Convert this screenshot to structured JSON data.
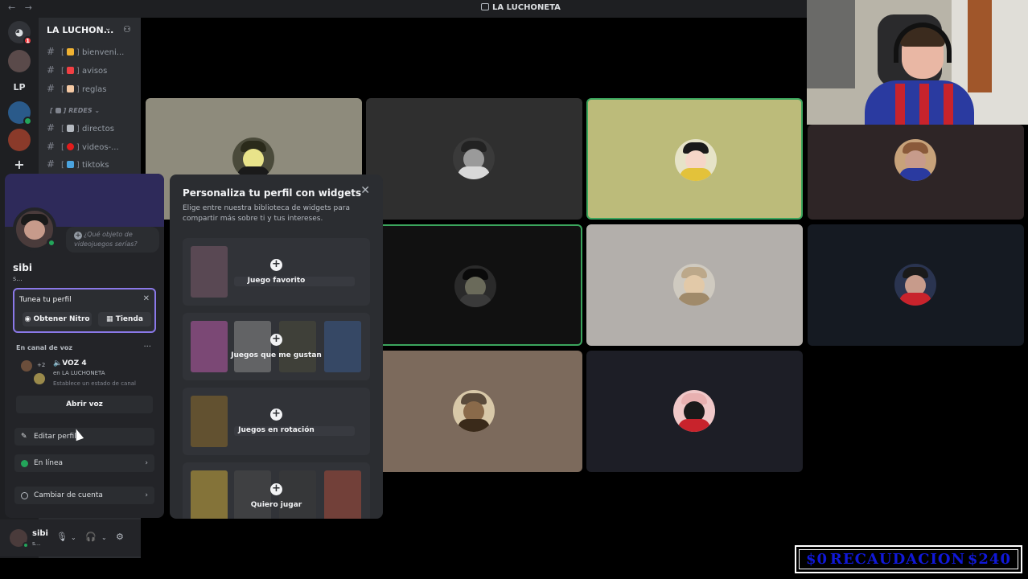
{
  "window": {
    "nav": "← →",
    "title": "LA LUCHONETA"
  },
  "rail": {
    "servers": [
      {
        "icon": "discord-icon",
        "badge": "1"
      },
      {
        "icon": "server-avatar"
      },
      {
        "label": "LP"
      },
      {
        "icon": "server-avatar"
      },
      {
        "icon": "server-avatar"
      },
      {
        "icon": "add-server-icon",
        "label": "+"
      }
    ]
  },
  "sidebar": {
    "server_name": "LA LUCHON...",
    "channels": [
      {
        "label": "bienveni...",
        "emoji_color": "#f0b232"
      },
      {
        "label": "avisos",
        "emoji_color": "#f23f43"
      },
      {
        "label": "reglas",
        "emoji_color": "#f5c9a4"
      },
      {
        "category": "REDES"
      },
      {
        "label": "directos",
        "emoji_color": "#b5bac1"
      },
      {
        "label": "videos-...",
        "emoji_color": "#e31c1c"
      },
      {
        "label": "tiktoks",
        "emoji_color": "#4aa3df"
      }
    ]
  },
  "profile": {
    "status_placeholder": "¿Qué objeto de videojuegos serías?",
    "username": "sibi",
    "subtitle": "s...",
    "nitro": {
      "title": "Tunea tu perfil",
      "btn_nitro": "Obtener Nitro",
      "btn_shop": "Tienda"
    },
    "voice": {
      "label": "En canal de voz",
      "more": "···",
      "plus_count": "+2",
      "channel": "VOZ 4",
      "server": "en LA LUCHONETA",
      "set_status": "Establece un estado de canal",
      "open": "Abrir voz"
    },
    "menu": {
      "edit": "Editar perfil",
      "status": "En línea",
      "switch": "Cambiar de cuenta"
    }
  },
  "userbar": {
    "name": "sibi",
    "sub": "s..."
  },
  "widgets": {
    "title": "Personaliza tu perfil con widgets",
    "description": "Elige entre nuestra biblioteca de widgets para compartir más sobre ti y tus intereses.",
    "cards": [
      {
        "label": "Juego favorito"
      },
      {
        "label": "Juegos que me gustan"
      },
      {
        "label": "Juegos en rotación"
      },
      {
        "label": "Quiero jugar"
      }
    ]
  },
  "overlay": {
    "left": "$0",
    "middle": "RECAUDACION",
    "right": "$240"
  },
  "colors": {
    "speaking_border": "#3ba55d",
    "accent": "#8a78e8",
    "overlay_text": "#1018d8"
  }
}
